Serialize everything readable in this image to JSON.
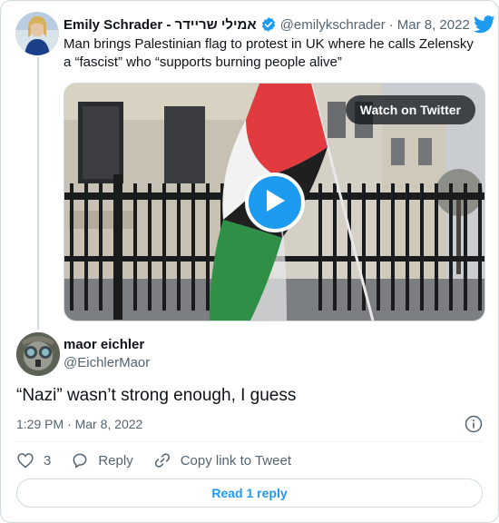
{
  "parent_tweet": {
    "author_name": "Emily Schrader - אמילי שריידר",
    "handle": "@emilykschrader",
    "separator": "·",
    "date": "Mar 8, 2022",
    "text": "Man brings Palestinian flag to protest in UK where he calls Zelensky a “fascist” who “supports burning people alive”",
    "media": {
      "watch_label": "Watch on Twitter",
      "play_icon": "play-icon"
    }
  },
  "reply_tweet": {
    "author_name": "maor eichler",
    "handle": "@EichlerMaor",
    "text": "“Nazi” wasn’t strong enough, I guess",
    "time": "1:29 PM",
    "separator": "·",
    "date": "Mar 8, 2022"
  },
  "actions": {
    "like_count": "3",
    "reply_label": "Reply",
    "copy_label": "Copy link to Tweet"
  },
  "read_replies_label": "Read 1 reply",
  "colors": {
    "accent": "#1d9bf0",
    "text": "#0f1419",
    "secondary": "#536471",
    "border": "#cfd9de"
  }
}
